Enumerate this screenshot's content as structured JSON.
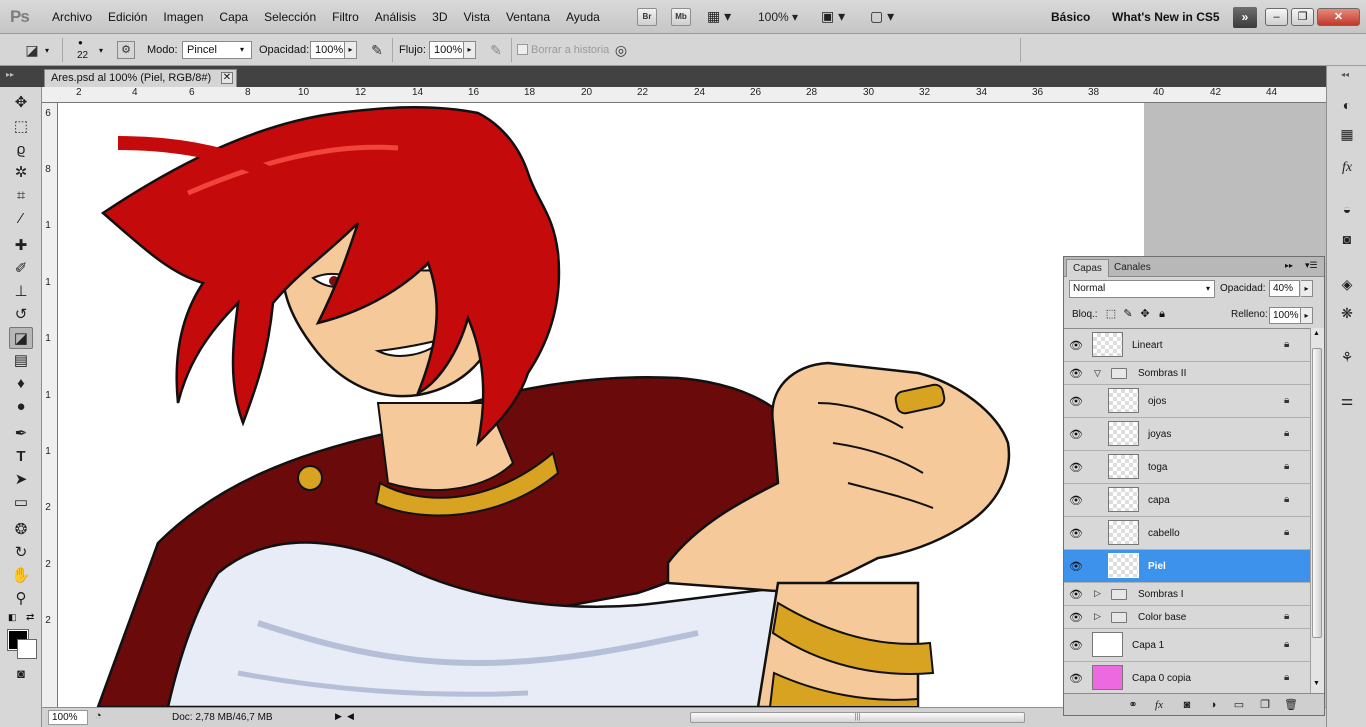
{
  "menubar": {
    "logo": "Ps",
    "menus": [
      "Archivo",
      "Edición",
      "Imagen",
      "Capa",
      "Selección",
      "Filtro",
      "Análisis",
      "3D",
      "Vista",
      "Ventana",
      "Ayuda"
    ],
    "bridge": "Br",
    "minibridge": "Mb",
    "zoom": "100%",
    "workspace_basic": "Básico",
    "workspace_new": "What's New in CS5"
  },
  "options": {
    "brush_size": "22",
    "mode_label": "Modo:",
    "mode_value": "Pincel",
    "opacity_label": "Opacidad:",
    "opacity_value": "100%",
    "flow_label": "Flujo:",
    "flow_value": "100%",
    "erase_history": "Borrar a historia"
  },
  "document": {
    "tab_title": "Ares.psd al 100% (Piel, RGB/8#)",
    "zoom": "100%",
    "doc_info": "Doc: 2,78 MB/46,7 MB"
  },
  "ruler": {
    "h_ticks": [
      "2",
      "4",
      "6",
      "8",
      "10",
      "12",
      "14",
      "16",
      "18",
      "20",
      "22",
      "24",
      "26",
      "28",
      "30",
      "32",
      "34",
      "36",
      "38",
      "40",
      "42",
      "44"
    ],
    "v_ticks": [
      "6",
      "8",
      "1",
      "1",
      "1",
      "1",
      "1",
      "2",
      "2",
      "2"
    ]
  },
  "layers_panel": {
    "tab_layers": "Capas",
    "tab_channels": "Canales",
    "blend_mode": "Normal",
    "opacity_label": "Opacidad:",
    "opacity_value": "40%",
    "lock_label": "Bloq.:",
    "fill_label": "Relleno:",
    "fill_value": "100%",
    "layers": [
      {
        "name": "Lineart",
        "type": "layer",
        "locked": true
      },
      {
        "name": "Sombras II",
        "type": "group-open",
        "locked": false
      },
      {
        "name": "ojos",
        "type": "layer",
        "locked": true
      },
      {
        "name": "joyas",
        "type": "layer",
        "locked": true
      },
      {
        "name": "toga",
        "type": "layer",
        "locked": true
      },
      {
        "name": "capa",
        "type": "layer",
        "locked": true
      },
      {
        "name": "cabello",
        "type": "layer",
        "locked": true
      },
      {
        "name": "Piel",
        "type": "layer",
        "selected": true,
        "locked": false
      },
      {
        "name": "Sombras I",
        "type": "group-closed",
        "locked": false
      },
      {
        "name": "Color base",
        "type": "group-closed",
        "locked": true
      },
      {
        "name": "Capa 1",
        "type": "layer",
        "locked": true
      },
      {
        "name": "Capa 0 copia",
        "type": "layer",
        "locked": true
      }
    ]
  },
  "colors": {
    "selected_layer": "#3d92ec",
    "hair_red": "#c40a0a",
    "cape_maroon": "#6a0a0a",
    "skin": "#f5c99a",
    "gold": "#d8a321"
  }
}
